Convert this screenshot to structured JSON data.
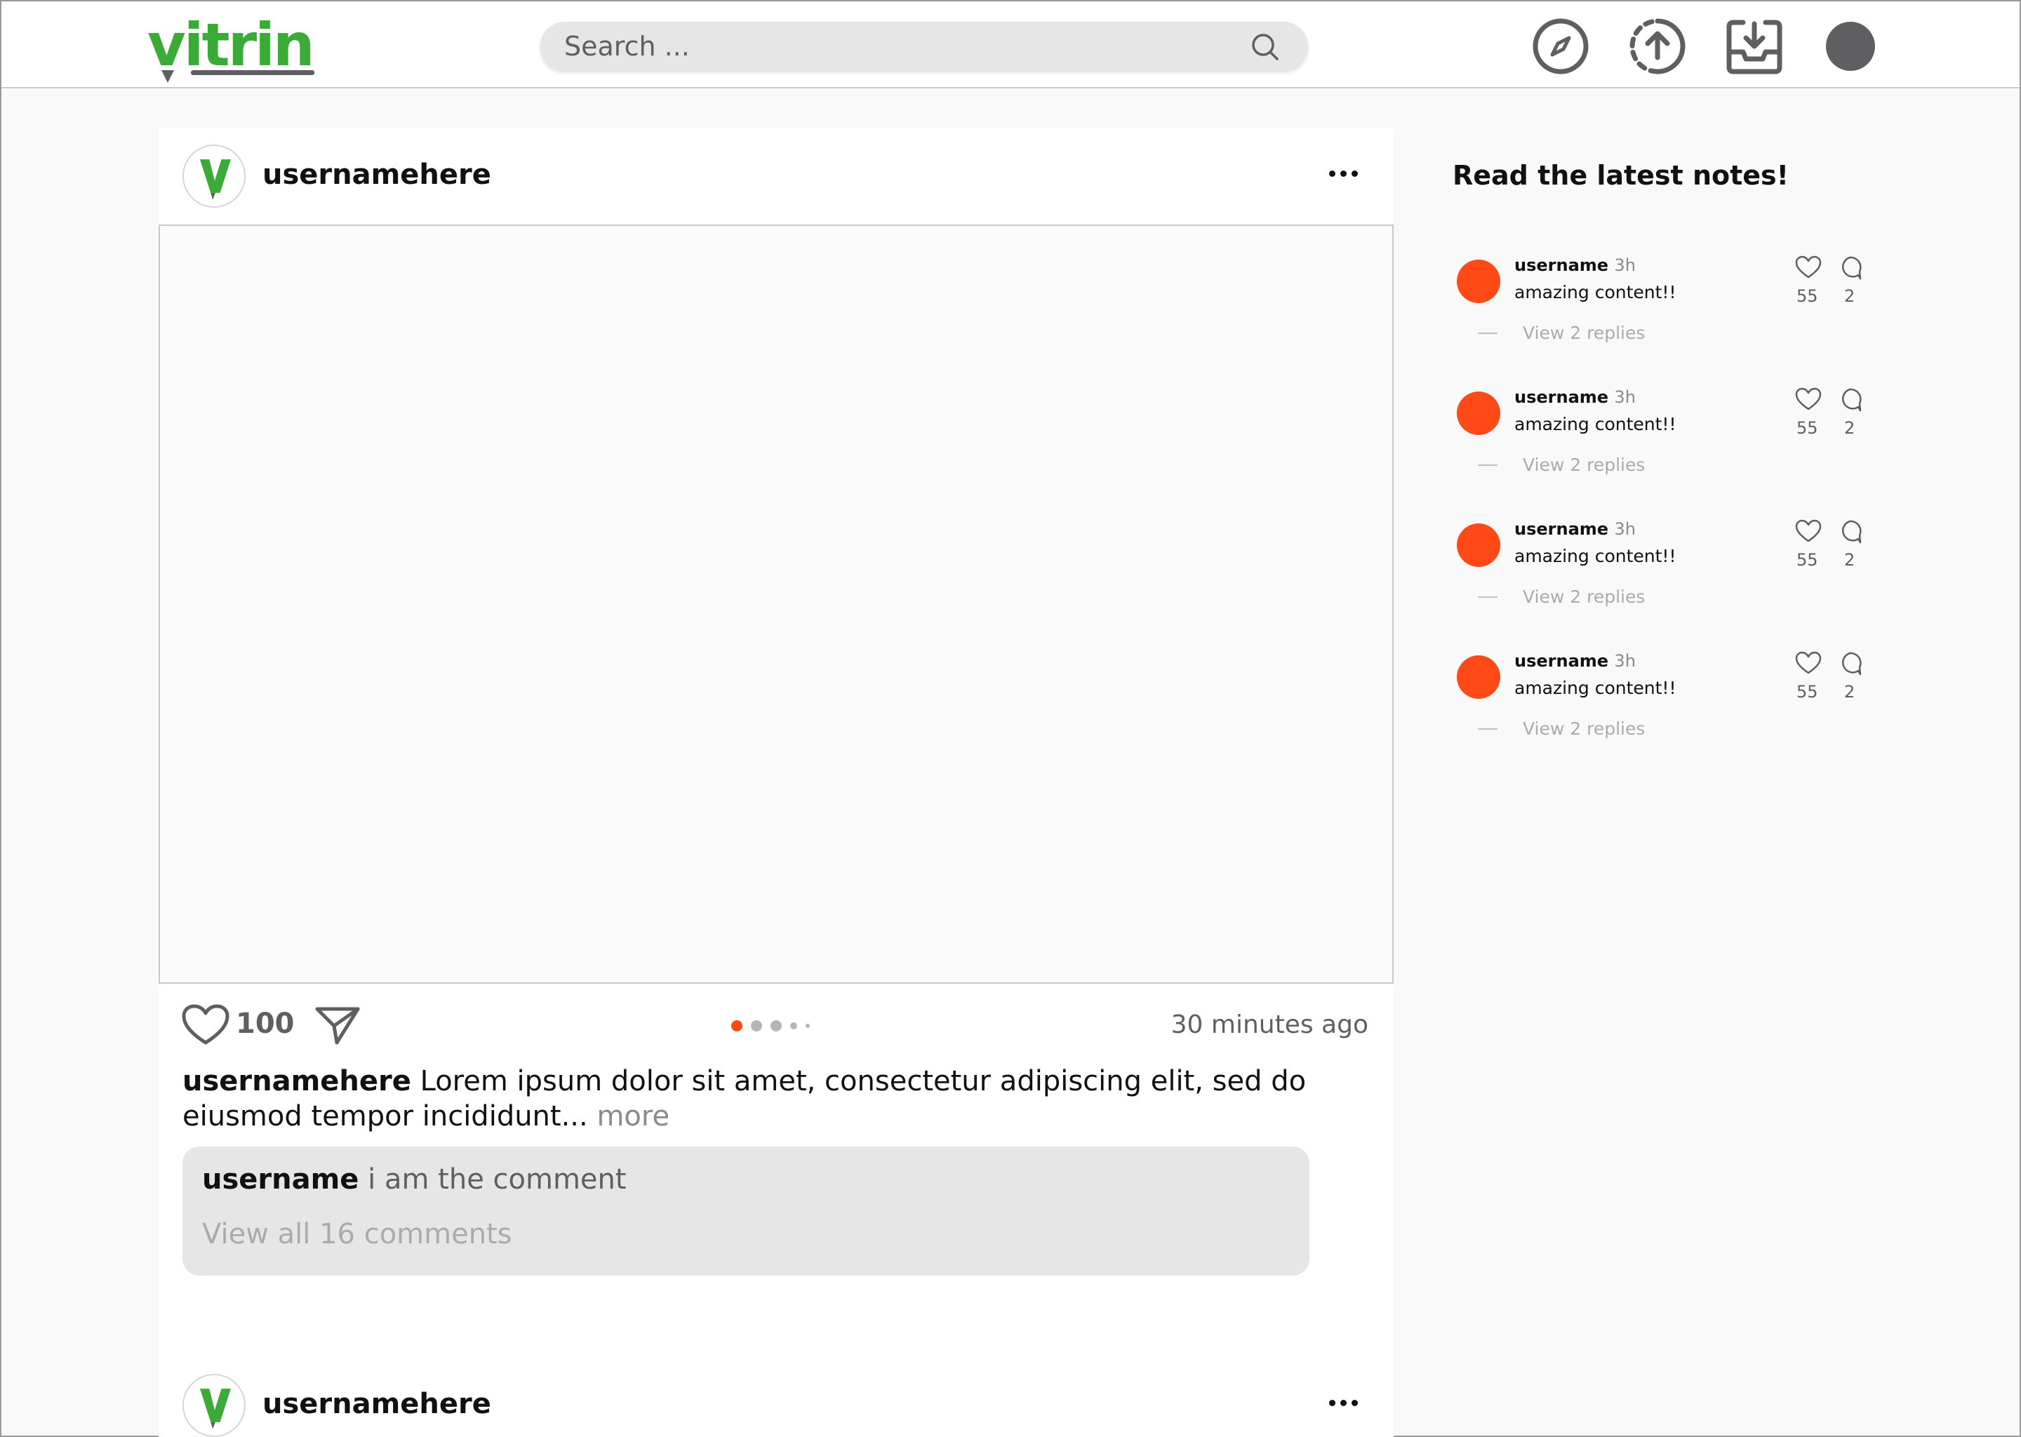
{
  "header": {
    "logo_text": "vitrin",
    "search_placeholder": "Search ...",
    "nav": [
      "compass-icon",
      "upload-icon",
      "inbox-download-icon",
      "profile-avatar"
    ]
  },
  "post": {
    "username": "usernamehere",
    "likes": "100",
    "time": "30 minutes ago",
    "carousel": {
      "total": 5,
      "active": 0
    },
    "caption_user": "usernamehere",
    "caption_text": "Lorem ipsum dolor sit amet, consectetur adipiscing elit, sed do eiusmod tempor incididunt...",
    "caption_more": "more",
    "comment_user": "username",
    "comment_text": "i am the comment",
    "view_all_comments": "View all 16 comments"
  },
  "post2": {
    "username": "usernamehere"
  },
  "notes": {
    "title": "Read the latest notes!",
    "items": [
      {
        "user": "username",
        "time": "3h",
        "text": "amazing content!!",
        "likes": "55",
        "comments": "2",
        "replies": "View 2 replies"
      },
      {
        "user": "username",
        "time": "3h",
        "text": "amazing content!!",
        "likes": "55",
        "comments": "2",
        "replies": "View 2 replies"
      },
      {
        "user": "username",
        "time": "3h",
        "text": "amazing content!!",
        "likes": "55",
        "comments": "2",
        "replies": "View 2 replies"
      },
      {
        "user": "username",
        "time": "3h",
        "text": "amazing content!!",
        "likes": "55",
        "comments": "2",
        "replies": "View 2 replies"
      }
    ]
  },
  "colors": {
    "brand_green": "#3aab36",
    "accent_orange": "#ff4a17",
    "icon_gray": "#5f5f62"
  }
}
